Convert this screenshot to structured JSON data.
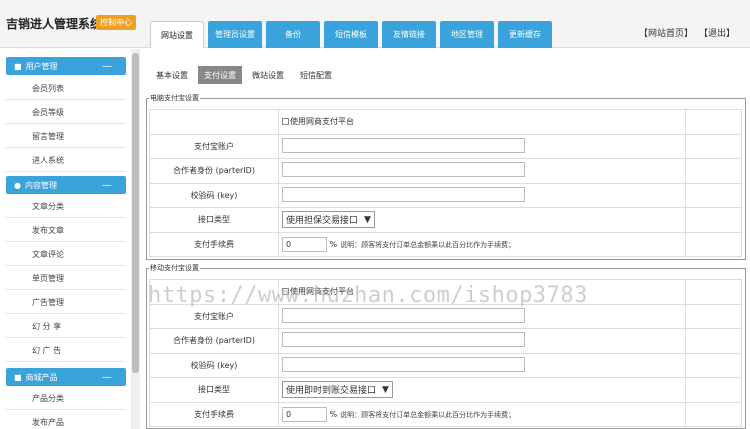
{
  "header": {
    "brand": "吉销进人管理系统",
    "badge": "控制中心",
    "tabs": [
      "网站设置",
      "管理员设置",
      "备份",
      "短信模板",
      "友情链接",
      "地区管理",
      "更新缓存"
    ],
    "active_tab": 0,
    "links": [
      "【网站首页】",
      "【退出】"
    ]
  },
  "sidebar": {
    "sections": [
      {
        "title": "用户管理",
        "items": [
          "会员列表",
          "会员等级",
          "留言管理",
          "进人系统"
        ]
      },
      {
        "title": "内容管理",
        "items": [
          "文章分类",
          "发布文章",
          "文章评论",
          "单页管理",
          "广告管理",
          "幻 分 享",
          "幻 广 告"
        ]
      },
      {
        "title": "商城产品",
        "items": [
          "产品分类",
          "发布产品"
        ]
      }
    ]
  },
  "subtabs": [
    "基本设置",
    "支付设置",
    "微站设置",
    "短信配置"
  ],
  "active_subtab": 1,
  "alipay_pc": {
    "legend": "电脑支付宝设置",
    "use_platform": "使用网商支付平台",
    "account_label": "支付宝账户",
    "partner_label": "合作者身份 (parterID)",
    "key_label": "校验码 (key)",
    "interface_label": "接口类型",
    "interface_value": "使用担保交易接口",
    "fee_label": "支付手续费",
    "fee_value": "0",
    "fee_unit": "%",
    "fee_note": "说明：顾客将支付订单总金额乘以此百分比作为手续费；"
  },
  "alipay_mobile": {
    "legend": "移动支付宝设置",
    "use_platform": "使用网商支付平台",
    "account_label": "支付宝账户",
    "partner_label": "合作者身份 (parterID)",
    "key_label": "校验码 (key)",
    "interface_label": "接口类型",
    "interface_value": "使用即时到账交易接口",
    "fee_label": "支付手续费",
    "fee_value": "0",
    "fee_unit": "%",
    "fee_note": "说明：顾客将支付订单总金额乘以此百分比作为手续费；"
  },
  "watermark": "https://www.huzhan.com/ishop3783"
}
